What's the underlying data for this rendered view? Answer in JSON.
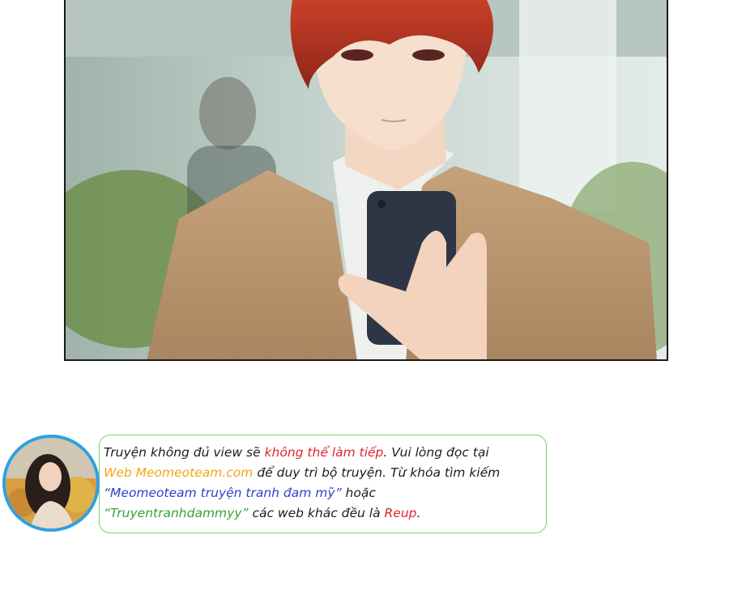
{
  "colors": {
    "accent_red": "#e0262a",
    "accent_orange": "#f0a515",
    "accent_blue": "#2a45c8",
    "accent_green": "#36a336",
    "border_green": "#6fd56b"
  },
  "notice": {
    "line1_part1": "Truyện không đủ view sẽ ",
    "line1_highlight": "không thể làm tiếp",
    "line1_part2": ". Vui lòng đọc tại",
    "line2_highlight": "Web Meomeoteam.com",
    "line2_part2": " để duy trì bộ truyện. Từ khóa tìm kiếm",
    "line3_highlight": "“Meomeoteam truyện tranh đam mỹ”",
    "line3_part2": " hoặc",
    "line4_highlight": "“Truyentranhdammyy”",
    "line4_part2": " các web khác đều là ",
    "line4_highlight2": "Reup",
    "line4_part3": "."
  }
}
